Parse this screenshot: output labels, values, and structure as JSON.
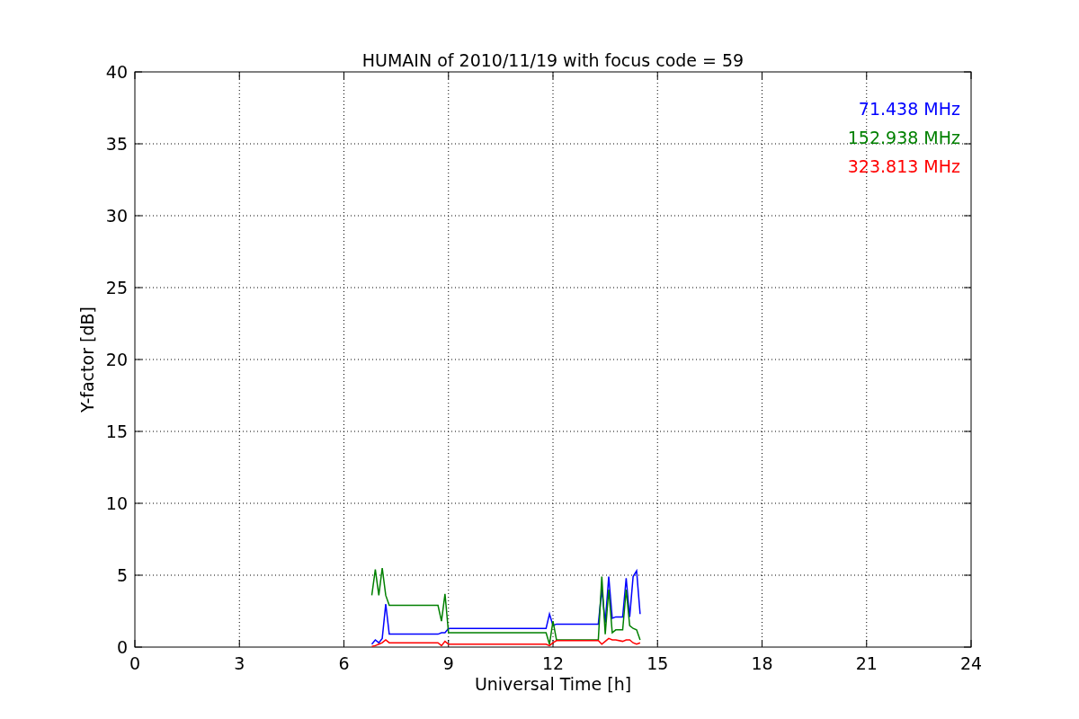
{
  "chart_data": {
    "type": "line",
    "title": "HUMAIN of 2010/11/19 with focus code = 59",
    "xlabel": "Universal Time [h]",
    "ylabel": "Y-factor [dB]",
    "x": [
      6.8,
      6.9,
      7.0,
      7.1,
      7.2,
      7.3,
      8.7,
      8.8,
      8.9,
      9.0,
      11.8,
      11.9,
      12.0,
      12.1,
      13.3,
      13.4,
      13.5,
      13.6,
      13.7,
      13.8,
      14.0,
      14.1,
      14.2,
      14.3,
      14.4,
      14.5
    ],
    "series": [
      {
        "name": "71.438 MHz",
        "color": "#0000ff",
        "values": [
          0.2,
          0.5,
          0.3,
          0.6,
          3.0,
          0.9,
          0.9,
          1.0,
          1.0,
          1.3,
          1.3,
          2.3,
          1.5,
          1.6,
          1.6,
          4.0,
          1.7,
          4.9,
          2.0,
          2.1,
          2.1,
          4.8,
          2.1,
          4.9,
          5.3,
          2.3
        ]
      },
      {
        "name": "152.938 MHz",
        "color": "#008000",
        "values": [
          3.6,
          5.4,
          3.6,
          5.5,
          3.6,
          2.9,
          2.9,
          1.8,
          3.7,
          1.0,
          1.0,
          0.2,
          1.8,
          0.5,
          0.5,
          4.9,
          0.9,
          4.0,
          1.0,
          1.2,
          1.2,
          4.0,
          1.5,
          1.3,
          1.2,
          0.5
        ]
      },
      {
        "name": "323.813 MHz",
        "color": "#ff0000",
        "values": [
          0.05,
          0.1,
          0.2,
          0.3,
          0.5,
          0.3,
          0.3,
          0.1,
          0.4,
          0.2,
          0.2,
          0.1,
          0.3,
          0.45,
          0.45,
          0.2,
          0.4,
          0.6,
          0.5,
          0.5,
          0.4,
          0.5,
          0.5,
          0.3,
          0.2,
          0.3
        ]
      }
    ],
    "xlim": [
      0,
      24
    ],
    "ylim": [
      0,
      40
    ],
    "xticks": [
      0,
      3,
      6,
      9,
      12,
      15,
      18,
      21,
      24
    ],
    "yticks": [
      0,
      5,
      10,
      15,
      20,
      25,
      30,
      35,
      40
    ],
    "grid": true
  }
}
